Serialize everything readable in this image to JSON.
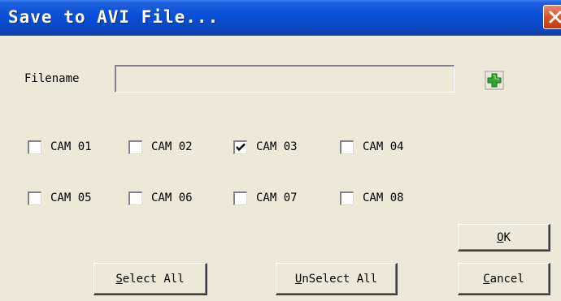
{
  "window": {
    "title": "Save to AVI File...",
    "close_icon": "close-x-icon"
  },
  "filename": {
    "label": "Filename",
    "value": "",
    "add_icon": "green-plus-icon"
  },
  "cameras": [
    {
      "label": "CAM 01",
      "checked": false
    },
    {
      "label": "CAM 02",
      "checked": false
    },
    {
      "label": "CAM 03",
      "checked": true
    },
    {
      "label": "CAM 04",
      "checked": false
    },
    {
      "label": "CAM 05",
      "checked": false
    },
    {
      "label": "CAM 06",
      "checked": false
    },
    {
      "label": "CAM 07",
      "checked": false
    },
    {
      "label": "CAM 08",
      "checked": false
    }
  ],
  "buttons": {
    "ok": {
      "mnemonic": "O",
      "rest": "K"
    },
    "cancel": {
      "mnemonic": "C",
      "rest": "ancel"
    },
    "select_all": {
      "mnemonic": "S",
      "rest": "elect All"
    },
    "unselect_all": {
      "mnemonic": "U",
      "rest": "nSelect All"
    }
  },
  "colors": {
    "titlebar": "#0a4fd8",
    "dialog_bg": "#ece9d8",
    "close_button": "#d9532a",
    "plus_icon": "#2fa830"
  }
}
